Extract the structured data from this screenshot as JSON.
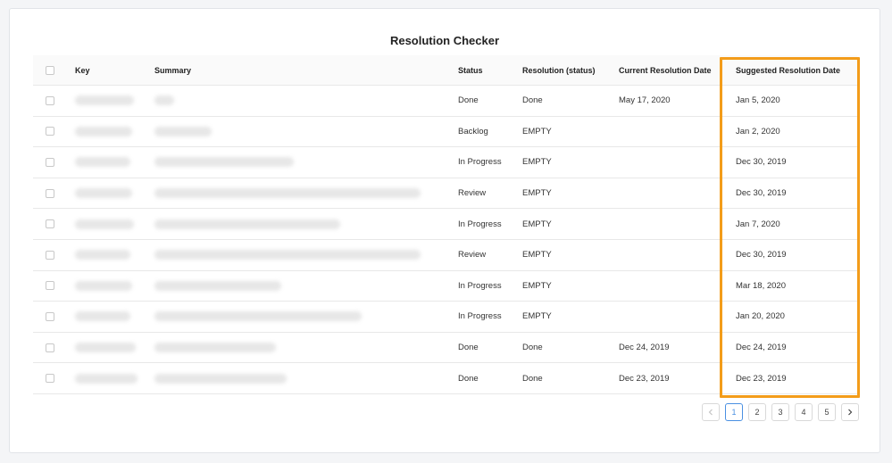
{
  "title": "Resolution Checker",
  "columns": {
    "key": "Key",
    "summary": "Summary",
    "status": "Status",
    "resolution": "Resolution (status)",
    "current": "Current Resolution Date",
    "suggested": "Suggested Resolution Date"
  },
  "rows": [
    {
      "status": "Done",
      "resolution": "Done",
      "current": "May 17, 2020",
      "suggested": "Jan 5, 2020"
    },
    {
      "status": "Backlog",
      "resolution": "EMPTY",
      "current": "",
      "suggested": "Jan 2, 2020"
    },
    {
      "status": "In Progress",
      "resolution": "EMPTY",
      "current": "",
      "suggested": "Dec 30, 2019"
    },
    {
      "status": "Review",
      "resolution": "EMPTY",
      "current": "",
      "suggested": "Dec 30, 2019"
    },
    {
      "status": "In Progress",
      "resolution": "EMPTY",
      "current": "",
      "suggested": "Jan 7, 2020"
    },
    {
      "status": "Review",
      "resolution": "EMPTY",
      "current": "",
      "suggested": "Dec 30, 2019"
    },
    {
      "status": "In Progress",
      "resolution": "EMPTY",
      "current": "",
      "suggested": "Mar 18, 2020"
    },
    {
      "status": "In Progress",
      "resolution": "EMPTY",
      "current": "",
      "suggested": "Jan 20, 2020"
    },
    {
      "status": "Done",
      "resolution": "Done",
      "current": "Dec 24, 2019",
      "suggested": "Dec 24, 2019"
    },
    {
      "status": "Done",
      "resolution": "Done",
      "current": "Dec 23, 2019",
      "suggested": "Dec 23, 2019"
    }
  ],
  "pagination": {
    "prev_icon": "chevron-left-icon",
    "next_icon": "chevron-right-icon",
    "pages": [
      "1",
      "2",
      "3",
      "4",
      "5"
    ],
    "current": "1"
  },
  "colors": {
    "highlight": "#f39c1a",
    "active_page": "#4a90e2"
  }
}
